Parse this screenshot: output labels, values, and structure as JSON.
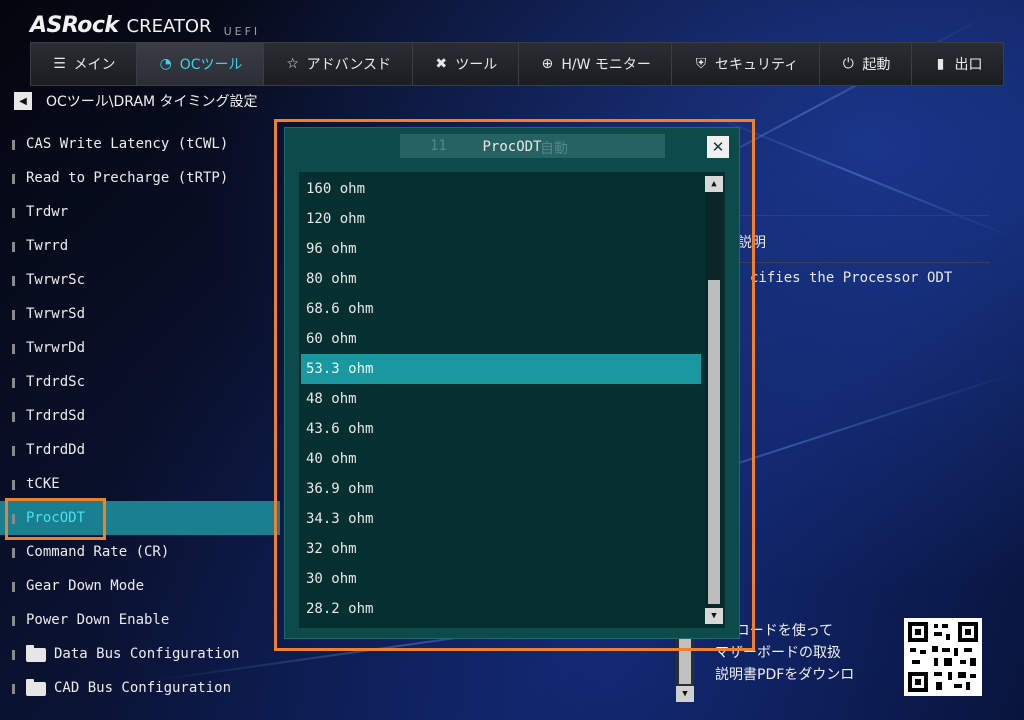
{
  "brand": {
    "logo": "ASRock",
    "product": "CREATOR",
    "uefi": "UEFI"
  },
  "tabs": [
    {
      "label": "メイン",
      "icon": "list-icon",
      "active": false
    },
    {
      "label": "OCツール",
      "icon": "gauge-icon",
      "active": true
    },
    {
      "label": "アドバンスド",
      "icon": "star-icon",
      "active": false
    },
    {
      "label": "ツール",
      "icon": "wrench-icon",
      "active": false
    },
    {
      "label": "H/W モニター",
      "icon": "crosshair-icon",
      "active": false
    },
    {
      "label": "セキュリティ",
      "icon": "shield-icon",
      "active": false
    },
    {
      "label": "起動",
      "icon": "power-icon",
      "active": false
    },
    {
      "label": "出口",
      "icon": "exit-icon",
      "active": false
    }
  ],
  "breadcrumb": {
    "path": "OCツール\\DRAM タイミング設定"
  },
  "menu": {
    "items": [
      {
        "label": "CAS Write Latency (tCWL)"
      },
      {
        "label": "Read to Precharge (tRTP)"
      },
      {
        "label": "Trdwr"
      },
      {
        "label": "Twrrd"
      },
      {
        "label": "TwrwrSc"
      },
      {
        "label": "TwrwrSd"
      },
      {
        "label": "TwrwrDd"
      },
      {
        "label": "TrdrdSc"
      },
      {
        "label": "TrdrdSd"
      },
      {
        "label": "TrdrdDd"
      },
      {
        "label": "tCKE"
      },
      {
        "label": "ProcODT",
        "selected": true
      },
      {
        "label": "Command Rate (CR)"
      },
      {
        "label": "Gear Down Mode"
      },
      {
        "label": "Power Down Enable"
      },
      {
        "label": "Data Bus Configuration",
        "folder": true
      },
      {
        "label": "CAD Bus Configuration",
        "folder": true
      }
    ]
  },
  "description": {
    "title": "説明",
    "text": "cifies the Processor ODT"
  },
  "qr": {
    "lines": [
      "QRコードを使って",
      "マザーボードの取扱",
      "説明書PDFをダウンロ"
    ]
  },
  "dialog": {
    "title": "ProcODT",
    "background_values": [
      "11",
      "自動"
    ],
    "options": [
      "160 ohm",
      "120 ohm",
      "96 ohm",
      "80 ohm",
      "68.6 ohm",
      "60 ohm",
      "53.3 ohm",
      "48 ohm",
      "43.6 ohm",
      "40 ohm",
      "36.9 ohm",
      "34.3 ohm",
      "32 ohm",
      "30 ohm",
      "28.2 ohm"
    ],
    "selected_index": 6
  },
  "colors": {
    "accent": "#3fd0e8",
    "highlight": "#f0812c",
    "dialog_bg": "#0d4a4a",
    "selected_row": "#1a98a0"
  }
}
